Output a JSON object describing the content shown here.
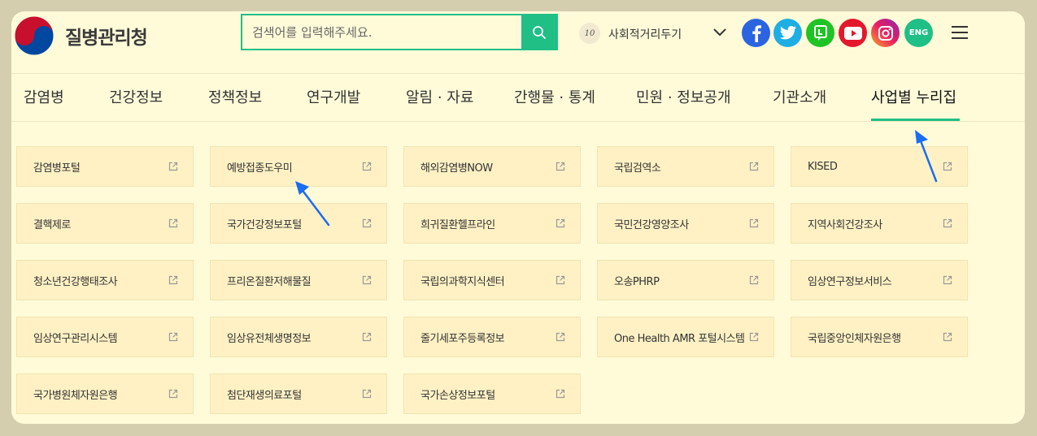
{
  "header": {
    "logo_text": "질병관리청",
    "search": {
      "placeholder": "검색어를 입력해주세요."
    },
    "distance_badge": "10",
    "distance_label": "사회적거리두기",
    "eng_label": "ENG"
  },
  "colors": {
    "accent": "#1fbf85",
    "facebook": "#2b64e0",
    "twitter": "#1eaee3",
    "kakao": "#20c325",
    "youtube": "#e3182c",
    "instagram": "#c8308c",
    "annotation_arrow": "#1a6cf2"
  },
  "nav": {
    "items": [
      "감염병",
      "건강정보",
      "정책정보",
      "연구개발",
      "알림 · 자료",
      "간행물 · 통계",
      "민원 · 정보공개",
      "기관소개",
      "사업별 누리집"
    ],
    "active": "사업별 누리집"
  },
  "sites": [
    "감염병포털",
    "예방접종도우미",
    "해외감염병NOW",
    "국립검역소",
    "KISED",
    "결핵제로",
    "국가건강정보포털",
    "희귀질환헬프라인",
    "국민건강영양조사",
    "지역사회건강조사",
    "청소년건강행태조사",
    "프리온질환저해물질",
    "국립의과학지식센터",
    "오송PHRP",
    "임상연구정보서비스",
    "임상연구관리시스템",
    "임상유전체생명정보",
    "줄기세포주등록정보",
    "One Health AMR 포털시스템",
    "국립중앙인체자원은행",
    "국가병원체자원은행",
    "첨단재생의료포털",
    "국가손상정보포털"
  ]
}
